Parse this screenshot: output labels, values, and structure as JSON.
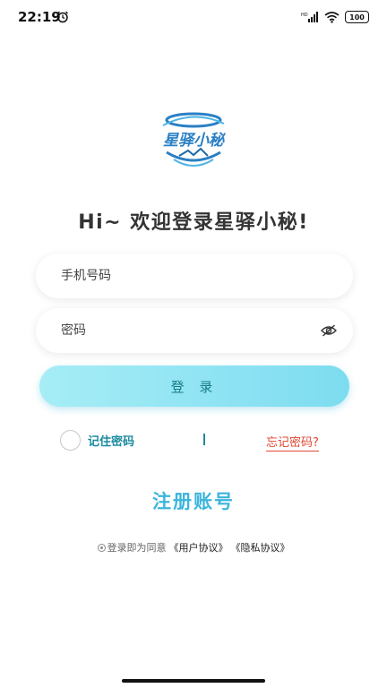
{
  "status_bar": {
    "time": "22:19",
    "battery": "100",
    "icons": [
      "alarm-icon",
      "signal-icon",
      "wifi-icon",
      "battery-icon"
    ]
  },
  "logo": {
    "text": "星驿小秘"
  },
  "welcome": "Hi~ 欢迎登录星驿小秘!",
  "phone_field": {
    "placeholder": "手机号码",
    "value": ""
  },
  "password_field": {
    "placeholder": "密码",
    "value": "",
    "toggle_icon": "eye-off-icon"
  },
  "login_button": "登 录",
  "remember_password": "记住密码",
  "forgot_password": "忘记密码?",
  "register": "注册账号",
  "agreement": {
    "prefix": "登录即为同意",
    "user_agreement": "《用户协议》",
    "privacy_agreement": "《隐私协议》"
  },
  "colors": {
    "accent": "#3bb5dc",
    "login_button": "#8fe3f3",
    "remember_text": "#1b8aa0",
    "forgot_text": "#e04632"
  }
}
